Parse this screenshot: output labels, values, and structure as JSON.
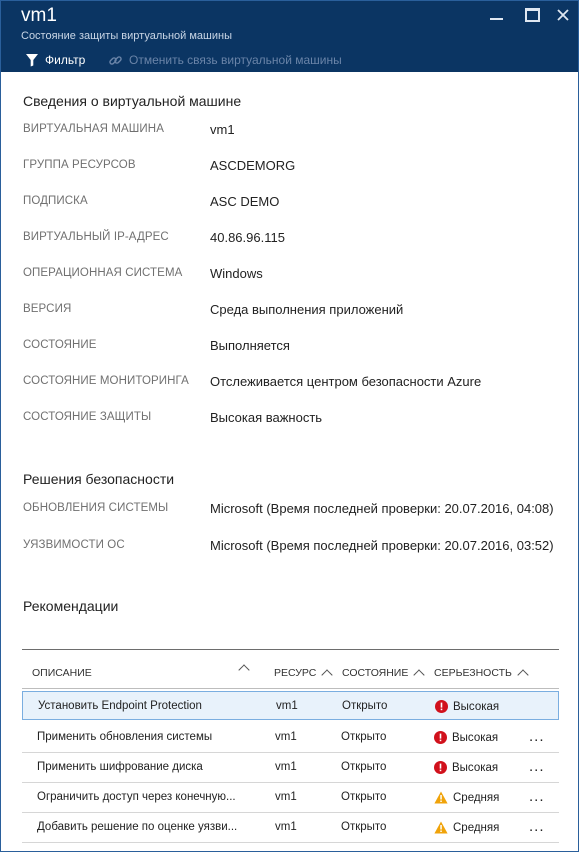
{
  "header": {
    "title": "vm1",
    "subtitle": "Состояние защиты виртуальной машины",
    "filter_label": "Фильтр",
    "unlink_label": "Отменить связь виртуальной машины"
  },
  "vm_section": {
    "title": "Сведения о виртуальной машине",
    "rows": [
      {
        "label": "ВИРТУАЛЬНАЯ МАШИНА",
        "value": "vm1"
      },
      {
        "label": "ГРУППА РЕСУРСОВ",
        "value": "ASCDEMORG"
      },
      {
        "label": "ПОДПИСКА",
        "value": "ASC DEMO"
      },
      {
        "label": "ВИРТУАЛЬНЫЙ IP-АДРЕС",
        "value": "40.86.96.115"
      },
      {
        "label": "ОПЕРАЦИОННАЯ СИСТЕМА",
        "value": "Windows"
      },
      {
        "label": "ВЕРСИЯ",
        "value": "Среда выполнения приложений"
      },
      {
        "label": "СОСТОЯНИЕ",
        "value": "Выполняется"
      },
      {
        "label": "СОСТОЯНИЕ МОНИТОРИНГА",
        "value": "Отслеживается центром безопасности Azure"
      },
      {
        "label": "СОСТОЯНИЕ ЗАЩИТЫ",
        "value": "Высокая важность"
      }
    ]
  },
  "security_section": {
    "title": "Решения безопасности",
    "rows": [
      {
        "label": "ОБНОВЛЕНИЯ СИСТЕМЫ",
        "value": "Microsoft (Время последней проверки: 20.07.2016, 04:08)"
      },
      {
        "label": "УЯЗВИМОСТИ ОС",
        "value": "Microsoft (Время последней проверки: 20.07.2016, 03:52)"
      }
    ]
  },
  "recommendations": {
    "title": "Рекомендации",
    "columns": {
      "description": "ОПИСАНИЕ",
      "resource": "РЕСУРС",
      "state": "СОСТОЯНИЕ",
      "severity": "СЕРЬЕЗНОСТЬ"
    },
    "rows": [
      {
        "description": "Установить Endpoint Protection",
        "resource": "vm1",
        "state": "Открыто",
        "severity": "Высокая",
        "severity_icon": "error-icon",
        "more": ""
      },
      {
        "description": "Применить обновления системы",
        "resource": "vm1",
        "state": "Открыто",
        "severity": "Высокая",
        "severity_icon": "error-icon",
        "more": "..."
      },
      {
        "description": "Применить шифрование диска",
        "resource": "vm1",
        "state": "Открыто",
        "severity": "Высокая",
        "severity_icon": "error-icon",
        "more": "..."
      },
      {
        "description": "Ограничить доступ через конечную...",
        "resource": "vm1",
        "state": "Открыто",
        "severity": "Средняя",
        "severity_icon": "warning-icon",
        "more": "..."
      },
      {
        "description": "Добавить решение по оценке уязви...",
        "resource": "vm1",
        "state": "Открыто",
        "severity": "Средняя",
        "severity_icon": "warning-icon",
        "more": "..."
      }
    ]
  },
  "colors": {
    "header_bg": "#0b3563",
    "high_severity": "#d1111c",
    "medium_severity": "#f0a30a",
    "selected_row": "#e8f2fb"
  }
}
